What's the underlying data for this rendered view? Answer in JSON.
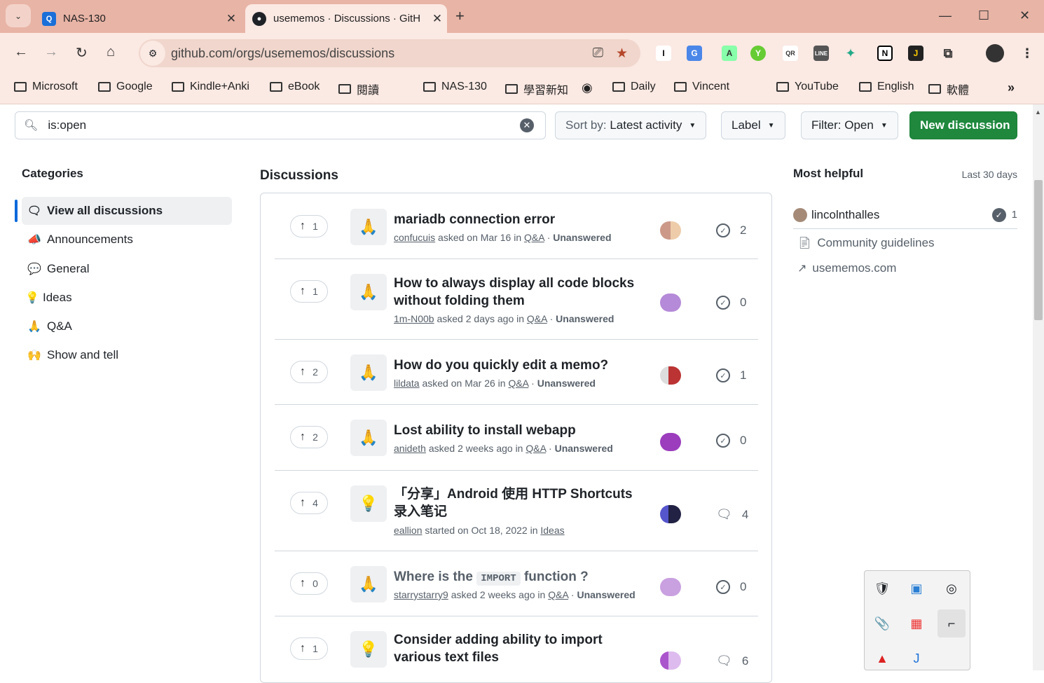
{
  "browser": {
    "tabs": [
      {
        "title": "NAS-130",
        "active": false
      },
      {
        "title": "usememos · Discussions · GitH",
        "active": true
      }
    ],
    "url": "github.com/orgs/usememos/discussions",
    "bookmarks": [
      "Microsoft",
      "Google",
      "Kindle+Anki",
      "eBook",
      "閱讀",
      "NAS-130",
      "學習新知",
      "Daily",
      "Vincent",
      "YouTube",
      "English",
      "軟體"
    ],
    "extension_icons": [
      "I",
      "G",
      "A",
      "Y",
      "QR",
      "LINE",
      "N",
      "J"
    ]
  },
  "search": {
    "value": "is:open"
  },
  "controls": {
    "sort_prefix": "Sort by:",
    "sort_value": "Latest activity",
    "label": "Label",
    "filter": "Filter: Open",
    "new_discussion": "New discussion"
  },
  "sidebar": {
    "heading": "Categories",
    "items": [
      {
        "label": "View all discussions",
        "icon": "discussions-icon",
        "active": true
      },
      {
        "label": "Announcements",
        "icon": "megaphone-icon"
      },
      {
        "label": "General",
        "icon": "speech-bubble-icon"
      },
      {
        "label": "Ideas",
        "icon": "lightbulb-icon"
      },
      {
        "label": "Q&A",
        "icon": "folded-hands-icon"
      },
      {
        "label": "Show and tell",
        "icon": "raising-hands-icon"
      }
    ]
  },
  "discussions": {
    "heading": "Discussions",
    "items": [
      {
        "votes": "1",
        "title": "mariadb connection error",
        "author": "confucuis",
        "verb": "asked on Mar 16 in",
        "category": "Q&A",
        "status": "Unanswered",
        "count": "2",
        "stat_type": "answered-icon"
      },
      {
        "votes": "1",
        "title": "How to always display all code blocks without folding them",
        "author": "1m-N00b",
        "verb": "asked 2 days ago in",
        "category": "Q&A",
        "status": "Unanswered",
        "count": "0",
        "stat_type": "answered-icon"
      },
      {
        "votes": "2",
        "title": "How do you quickly edit a memo?",
        "author": "lildata",
        "verb": "asked on Mar 26 in",
        "category": "Q&A",
        "status": "Unanswered",
        "count": "1",
        "stat_type": "answered-icon"
      },
      {
        "votes": "2",
        "title": "Lost ability to install webapp",
        "author": "anideth",
        "verb": "asked 2 weeks ago in",
        "category": "Q&A",
        "status": "Unanswered",
        "count": "0",
        "stat_type": "answered-icon"
      },
      {
        "votes": "4",
        "title": "「分享」Android 使用 HTTP Shortcuts 录入笔记",
        "author": "eallion",
        "verb": "started on Oct 18, 2022 in",
        "category": "Ideas",
        "status": "",
        "count": "4",
        "stat_type": "comment-icon"
      },
      {
        "votes": "0",
        "title_pre": "Where is the",
        "title_code": "IMPORT",
        "title_post": "function ?",
        "author": "starrystarry9",
        "verb": "asked 2 weeks ago in",
        "category": "Q&A",
        "status": "Unanswered",
        "count": "0",
        "stat_type": "answered-icon"
      },
      {
        "votes": "1",
        "title": "Consider adding ability to import various text files",
        "author": "",
        "verb": "",
        "category": "",
        "status": "",
        "count": "6",
        "stat_type": "comment-icon"
      }
    ]
  },
  "most_helpful": {
    "heading": "Most helpful",
    "range": "Last 30 days",
    "user": "lincolnthalles",
    "count": "1",
    "links": [
      "Community guidelines",
      "usememos.com"
    ]
  }
}
